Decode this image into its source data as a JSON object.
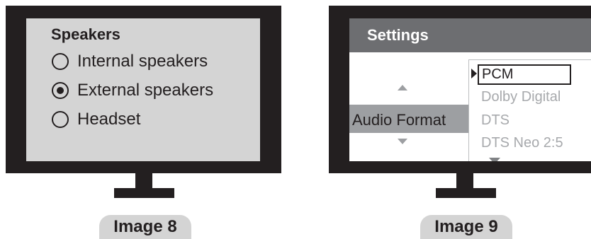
{
  "image8": {
    "title": "Speakers",
    "options": [
      {
        "label": "Internal speakers",
        "selected": false
      },
      {
        "label": "External speakers",
        "selected": true
      },
      {
        "label": "Headset",
        "selected": false
      }
    ],
    "caption": "Image 8"
  },
  "image9": {
    "title": "Settings",
    "setting_label": "Audio Format",
    "dropdown_items": [
      "PCM",
      "Dolby Digital",
      "DTS",
      "DTS Neo 2:5"
    ],
    "selected_item": "PCM",
    "caption": "Image 9"
  }
}
